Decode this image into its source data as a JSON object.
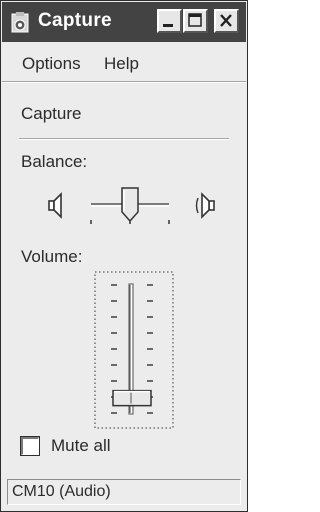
{
  "window": {
    "title": "Capture"
  },
  "menu": {
    "options": "Options",
    "help": "Help"
  },
  "device": {
    "name": "Capture"
  },
  "balance": {
    "label": "Balance:",
    "value": 0.5,
    "left_icon": "speaker-left-icon",
    "right_icon": "speaker-right-icon"
  },
  "volume": {
    "label": "Volume:",
    "value": 0.12
  },
  "mute": {
    "label": "Mute all",
    "checked": false
  },
  "status": {
    "text": "CM10 (Audio)"
  }
}
